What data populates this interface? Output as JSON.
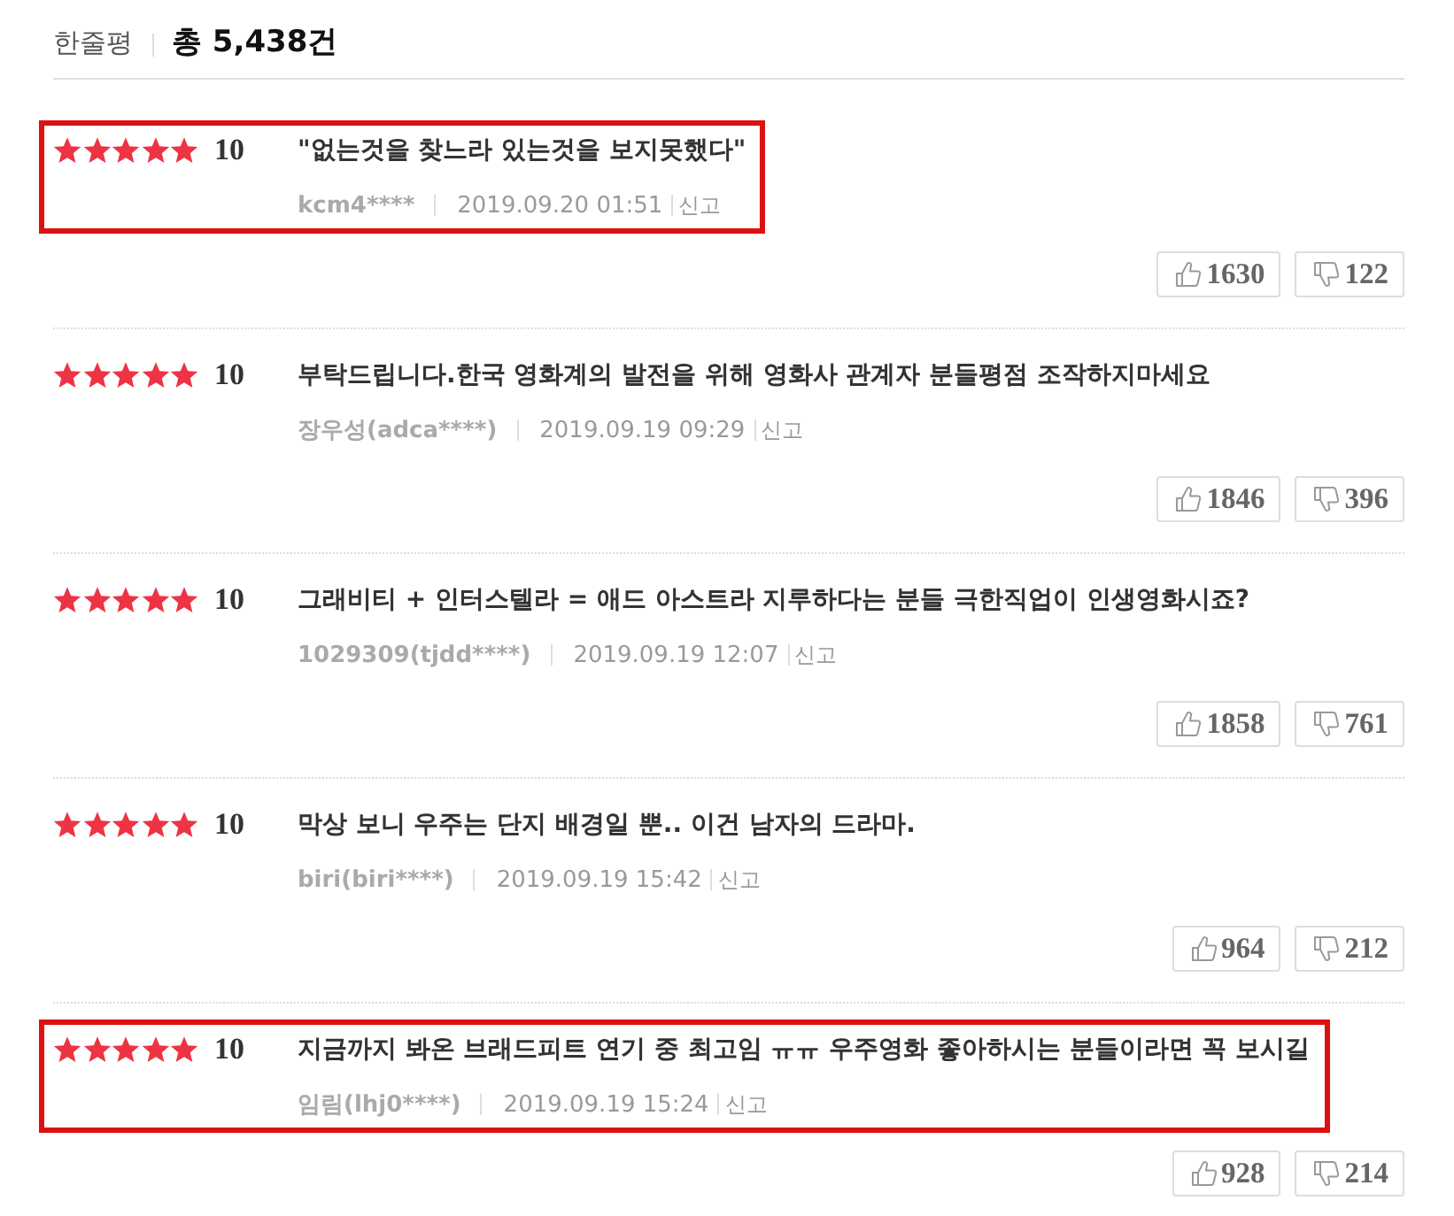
{
  "header": {
    "label": "한줄평",
    "total": "총 5,438건"
  },
  "reviews": [
    {
      "stars": 5,
      "score": "10",
      "text": "\"없는것을 찾느라 있는것을 보지못했다\"",
      "author": "kcm4****",
      "date": "2019.09.20 01:51",
      "report": "신고",
      "likes": "1630",
      "dislikes": "122",
      "highlighted": true
    },
    {
      "stars": 5,
      "score": "10",
      "text": "부탁드립니다.한국 영화계의 발전을 위해 영화사 관계자 분들평점 조작하지마세요",
      "author": "장우성(adca****)",
      "date": "2019.09.19 09:29",
      "report": "신고",
      "likes": "1846",
      "dislikes": "396",
      "highlighted": false
    },
    {
      "stars": 5,
      "score": "10",
      "text": "그래비티 + 인터스텔라 = 애드 아스트라 지루하다는 분들 극한직업이 인생영화시죠?",
      "author": "1029309(tjdd****)",
      "date": "2019.09.19 12:07",
      "report": "신고",
      "likes": "1858",
      "dislikes": "761",
      "highlighted": false
    },
    {
      "stars": 5,
      "score": "10",
      "text": "막상 보니 우주는 단지 배경일 뿐.. 이건 남자의 드라마.",
      "author": "biri(biri****)",
      "date": "2019.09.19 15:42",
      "report": "신고",
      "likes": "964",
      "dislikes": "212",
      "highlighted": false
    },
    {
      "stars": 5,
      "score": "10",
      "text": "지금까지 봐온 브래드피트 연기 중 최고임 ㅠㅠ 우주영화 좋아하시는 분들이라면 꼭 보시길",
      "author": "임림(lhj0****)",
      "date": "2019.09.19 15:24",
      "report": "신고",
      "likes": "928",
      "dislikes": "214",
      "highlighted": true
    }
  ]
}
